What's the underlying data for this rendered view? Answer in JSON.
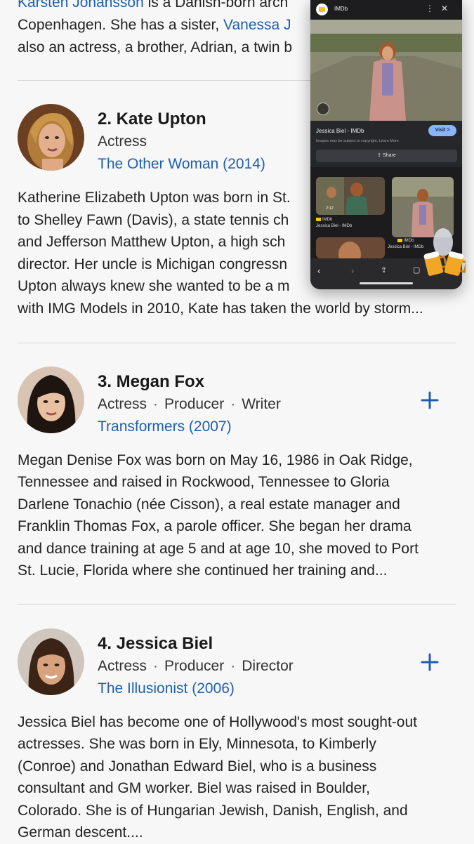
{
  "top_text": {
    "line1_link": "Karsten Johansson",
    "line1_rest": " is a Danish-born arch",
    "line2_start": "Copenhagen. She has a sister, ",
    "line2_link": "Vanessa J",
    "line3": "also an actress, a brother, Adrian, a twin b"
  },
  "people": [
    {
      "name": "2. Kate Upton",
      "roles": [
        "Actress"
      ],
      "film": "The Other Woman (2014)",
      "bio": [
        "Katherine Elizabeth Upton was born in St.",
        "to Shelley Fawn (Davis), a state tennis ch",
        "and Jefferson Matthew Upton, a high sch",
        "director. Her uncle is Michigan congressn",
        "Upton always knew she wanted to be a m",
        "with IMG Models in 2010, Kate has taken the world by storm..."
      ]
    },
    {
      "name": "3. Megan Fox",
      "roles": [
        "Actress",
        "Producer",
        "Writer"
      ],
      "film": "Transformers (2007)",
      "bio": [
        "Megan Denise Fox was born on May 16, 1986 in Oak Ridge,",
        "Tennessee and raised in Rockwood, Tennessee to Gloria",
        "Darlene Tonachio (née Cisson), a real estate manager and",
        "Franklin Thomas Fox, a parole officer. She began her drama",
        "and dance training at age 5 and at age 10, she moved to Port",
        "St. Lucie, Florida where she continued her training and..."
      ]
    },
    {
      "name": "4. Jessica Biel",
      "roles": [
        "Actress",
        "Producer",
        "Director"
      ],
      "film": "The Illusionist (2006)",
      "bio": [
        "Jessica Biel has become one of Hollywood's most sought-out",
        "actresses. She was born in Ely, Minnesota, to Kimberly",
        "(Conroe) and Jonathan Edward Biel, who is a business",
        "consultant and GM worker. Biel was raised in Boulder,",
        "Colorado. She is of Hungarian Jewish, Danish, English, and",
        "German descent...."
      ]
    }
  ],
  "role_separator": "·",
  "panel": {
    "site": "IMDb",
    "result_title": "Jessica Biel - IMDb",
    "visit_label": "Visit >",
    "copyright_note": "Images may be subject to copyright. Learn More",
    "share_label": "Share",
    "thumb1_duration": "2:12",
    "thumb1_source": "IMDb",
    "thumb1_caption": "Jessica Biel - IMDb",
    "thumb2_source": "IMDb",
    "thumb2_caption": "Jessica Biel - IMDb",
    "icons": [
      "more-vert-icon",
      "close-icon",
      "lens-icon",
      "back-icon",
      "forward-icon",
      "share-icon",
      "bookmarks-icon"
    ]
  },
  "colors": {
    "link": "#1f5fb0",
    "background": "#f7f7f7",
    "visit_button": "#8ab4f8",
    "imdb_yellow": "#f5c518"
  }
}
